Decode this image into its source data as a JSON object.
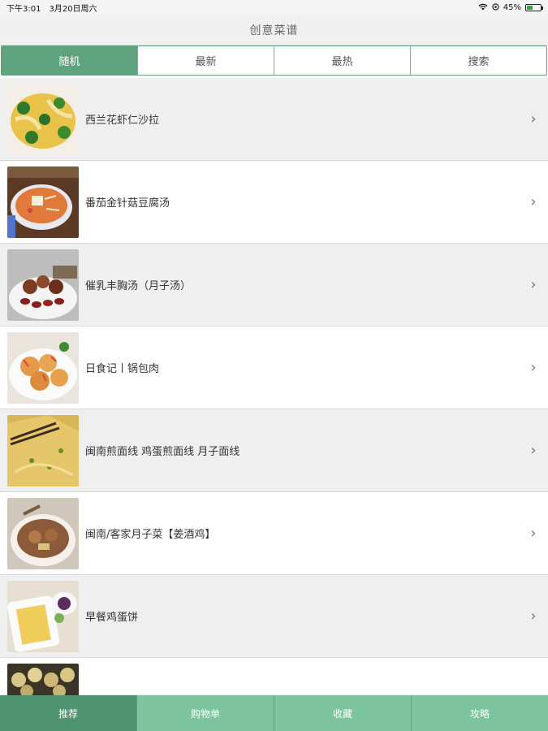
{
  "status_bar": {
    "time": "下午3:01",
    "date": "3月20日周六",
    "battery_percent": "45%",
    "battery_level": 0.45,
    "icons": [
      "wifi-icon",
      "location-icon",
      "battery-icon"
    ]
  },
  "header": {
    "title": "创意菜谱"
  },
  "segments": [
    {
      "label": "随机",
      "active": true
    },
    {
      "label": "最新",
      "active": false
    },
    {
      "label": "最热",
      "active": false
    },
    {
      "label": "搜索",
      "active": false
    }
  ],
  "recipes": [
    {
      "title": "西兰花虾仁沙拉"
    },
    {
      "title": "番茄金针菇豆腐汤"
    },
    {
      "title": "催乳丰胸汤（月子汤）"
    },
    {
      "title": "日食记丨锅包肉"
    },
    {
      "title": "闽南煎面线 鸡蛋煎面线 月子面线"
    },
    {
      "title": "闽南/客家月子菜【姜酒鸡】"
    },
    {
      "title": "早餐鸡蛋饼"
    },
    {
      "title": ""
    }
  ],
  "tabs": [
    {
      "label": "推荐",
      "active": true
    },
    {
      "label": "购物单",
      "active": false
    },
    {
      "label": "收藏",
      "active": false
    },
    {
      "label": "攻略",
      "active": false
    }
  ],
  "colors": {
    "accent": "#5fa37e",
    "tab_bar": "#7cc39e",
    "tab_active": "#4e9470"
  }
}
